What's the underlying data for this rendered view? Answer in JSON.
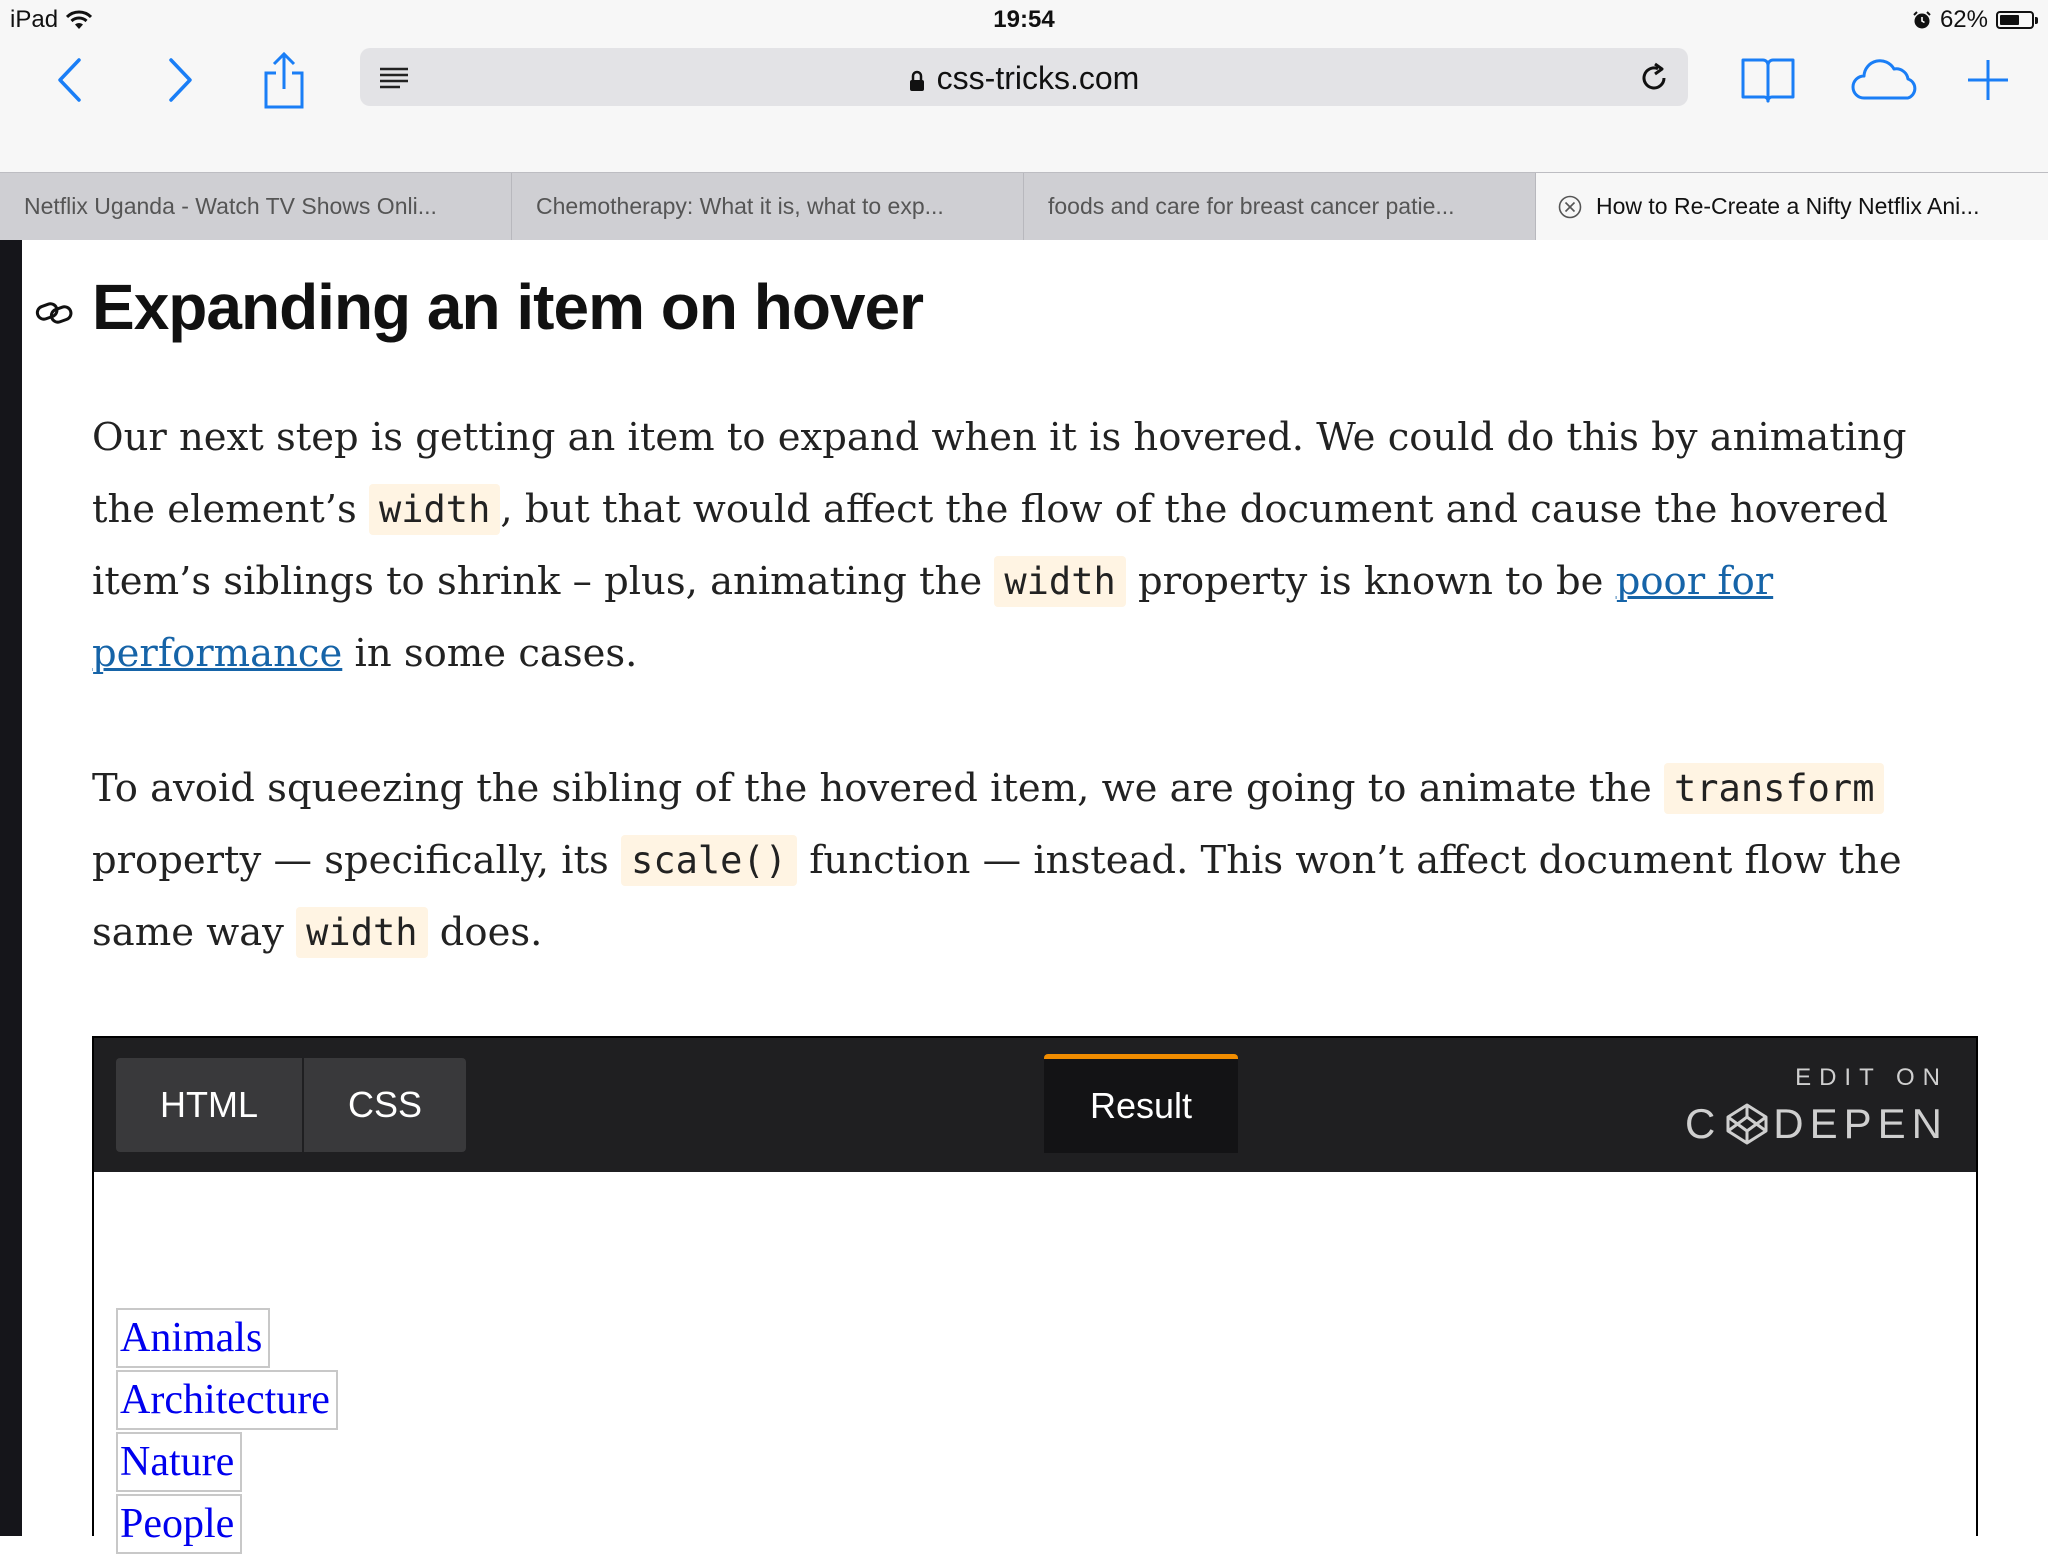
{
  "status_bar": {
    "device": "iPad",
    "time": "19:54",
    "battery": "62%",
    "battery_level": 0.62
  },
  "toolbar": {
    "url": "css-tricks.com",
    "icons": [
      "back-icon",
      "forward-icon",
      "share-icon",
      "reader-icon",
      "lock-icon",
      "reload-icon",
      "bookmarks-icon",
      "cloud-tabs-icon",
      "new-tab-icon"
    ]
  },
  "tabs": [
    {
      "title": "Netflix Uganda - Watch TV Shows Onli..."
    },
    {
      "title": "Chemotherapy: What it is, what to exp..."
    },
    {
      "title": "foods and care for breast cancer patie..."
    },
    {
      "title": "How to Re-Create a Nifty Netflix Ani...",
      "active": true
    }
  ],
  "article": {
    "heading": "Expanding an item on hover",
    "p1": {
      "t1": "Our next step is getting an item to expand when it is hovered. We could do this by animating the element’s ",
      "c1": "width",
      "t2": ", but that would affect the flow of the document and cause the hovered item’s siblings to shrink – plus, animating the ",
      "c2": "width",
      "t3": " property is known to be ",
      "link": "poor for performance",
      "t4": " in some cases."
    },
    "p2": {
      "t1": "To avoid squeezing the sibling of the hovered item, we are going to animate the ",
      "c1": "transform",
      "t2": " property — specifically, its ",
      "c2": "scale()",
      "t3": " function — instead. This won’t affect document flow the same way ",
      "c3": "width",
      "t4": " does."
    }
  },
  "codepen": {
    "tabs": {
      "html": "HTML",
      "css": "CSS",
      "result": "Result"
    },
    "edit_on": "EDIT ON",
    "brand_left": "C",
    "brand_right": "DEPEN",
    "accent_color": "#f08c00",
    "result_items": [
      "Animals",
      "Architecture",
      "Nature",
      "People"
    ]
  }
}
